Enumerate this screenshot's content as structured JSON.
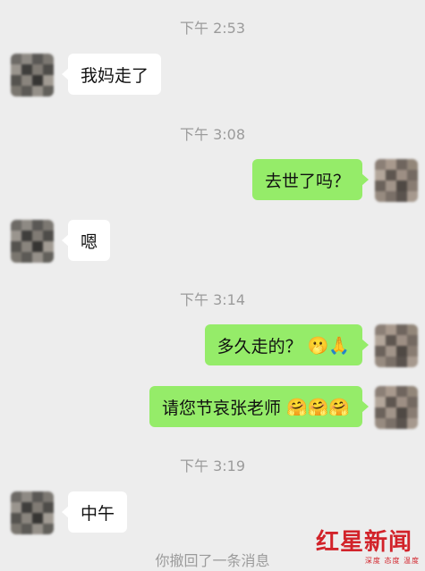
{
  "chat": {
    "timestamps": [
      "下午 2:53",
      "下午 3:08",
      "下午 3:14",
      "下午 3:19"
    ],
    "messages": [
      {
        "side": "left",
        "text": "我妈走了"
      },
      {
        "side": "right",
        "text": "去世了吗？"
      },
      {
        "side": "left",
        "text": "嗯"
      },
      {
        "side": "right",
        "text": "多久走的？",
        "emoji": "🫢🙏"
      },
      {
        "side": "right",
        "text": "请您节哀张老师",
        "emoji": "🤗🤗🤗"
      },
      {
        "side": "left",
        "text": "中午"
      }
    ],
    "system_notice": "你撤回了一条消息"
  },
  "watermark": {
    "main": "红星新闻",
    "sub": "深度 态度 温度"
  },
  "colors": {
    "background": "#ededed",
    "self_bubble": "#95ec69",
    "other_bubble": "#ffffff",
    "brand_red": "#d2232a"
  }
}
